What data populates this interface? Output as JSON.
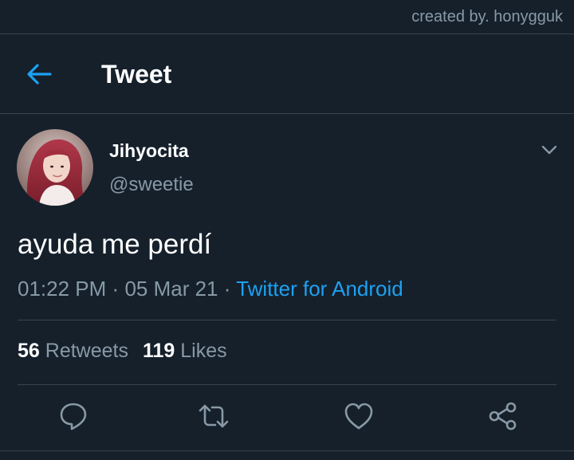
{
  "watermark": "created by. honygguk",
  "header": {
    "title": "Tweet",
    "back_icon": "arrow-left-icon"
  },
  "author": {
    "display_name": "Jihyocita",
    "handle": "@sweetie",
    "avatar": "profile-photo",
    "menu_icon": "chevron-down-icon"
  },
  "tweet": {
    "text": "ayuda me perdí",
    "time": "01:22 PM",
    "date": "05 Mar 21",
    "separator": "·",
    "source": "Twitter for Android"
  },
  "stats": {
    "retweets_count": "56",
    "retweets_label": "Retweets",
    "likes_count": "119",
    "likes_label": "Likes"
  },
  "actions": [
    {
      "name": "reply",
      "icon": "speech-bubble-icon"
    },
    {
      "name": "retweet",
      "icon": "retweet-arrows-icon"
    },
    {
      "name": "like",
      "icon": "heart-icon"
    },
    {
      "name": "share",
      "icon": "share-nodes-icon"
    }
  ],
  "colors": {
    "background": "#15202b",
    "accent": "#1da1f2",
    "secondary_text": "#8899a6",
    "divider": "#38444d"
  }
}
